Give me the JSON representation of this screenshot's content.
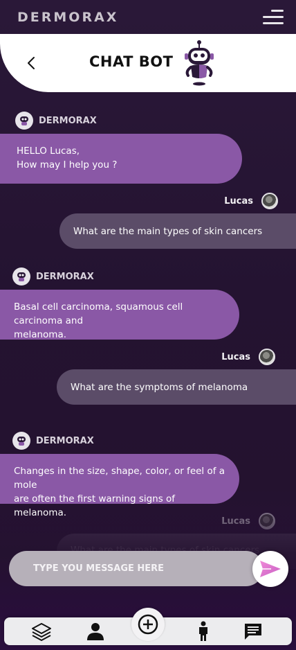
{
  "app": {
    "brand": "DERMORAX"
  },
  "header": {
    "title": "CHAT BOT"
  },
  "messages": [
    {
      "sender": "bot",
      "name": "DERMORAX",
      "text": "HELLO Lucas,\nHow may I help you ?"
    },
    {
      "sender": "user",
      "name": "Lucas",
      "text": "What are the main types of skin cancers"
    },
    {
      "sender": "bot",
      "name": "DERMORAX",
      "text": "Basal cell carcinoma, squamous cell carcinoma and\nmelanoma."
    },
    {
      "sender": "user",
      "name": "Lucas",
      "text": "What are the symptoms of melanoma"
    },
    {
      "sender": "bot",
      "name": "DERMORAX",
      "text": "Changes in the size, shape, color, or feel of a mole\nare often the first warning signs of melanoma."
    },
    {
      "sender": "user",
      "name": "Lucas",
      "text": "What are the main types of skin cancers"
    }
  ],
  "composer": {
    "placeholder": "TYPE YOU MESSAGE HERE"
  },
  "nav": {
    "items": [
      {
        "icon": "layers-icon"
      },
      {
        "icon": "user-icon"
      },
      {
        "icon": "plus-circle-icon"
      },
      {
        "icon": "person-standing-icon"
      },
      {
        "icon": "chat-icon"
      }
    ]
  },
  "colors": {
    "background": "#24122f",
    "bot_bubble": "#8a58a6",
    "user_bubble": "#5b4c68",
    "send_accent": "#e07ad8"
  }
}
